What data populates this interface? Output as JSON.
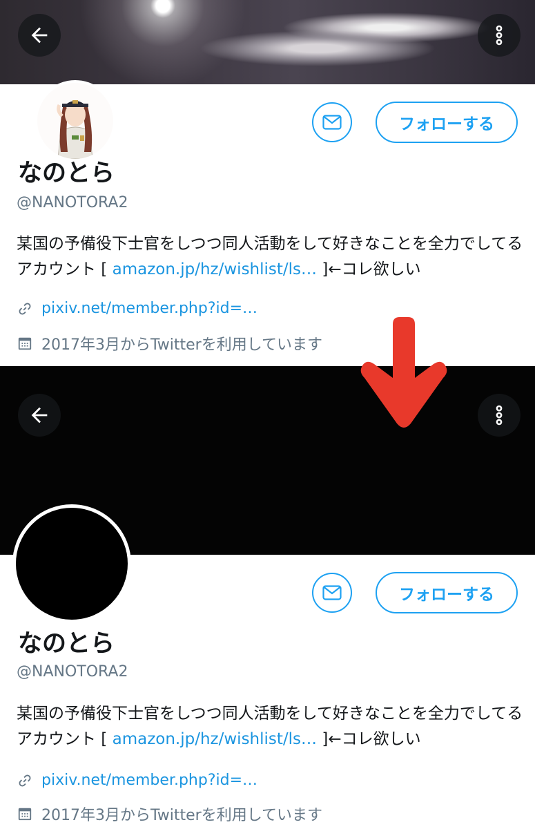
{
  "profile": {
    "display_name": "なのとら",
    "handle": "@NANOTORA2",
    "bio": {
      "text_before": "某国の予備役下士官をしつつ同人活動をして好きなことを全力でしてるアカウント [ ",
      "link_text": "amazon.jp/hz/wishlist/ls…",
      "text_after": " ]←コレ欲しい"
    },
    "website": "pixiv.net/member.php?id=…",
    "joined": "2017年3月からTwitterを利用しています"
  },
  "buttons": {
    "follow_label": "フォローする"
  },
  "icons": {
    "back": "back-arrow-icon",
    "more": "more-vertical-icon",
    "message": "envelope-icon",
    "link": "link-icon",
    "calendar": "calendar-icon",
    "annotation": "red-down-arrow"
  },
  "colors": {
    "accent": "#1da1f2",
    "link": "#1b95e0",
    "secondary_text": "#657786",
    "annotation_arrow": "#e8392b"
  }
}
